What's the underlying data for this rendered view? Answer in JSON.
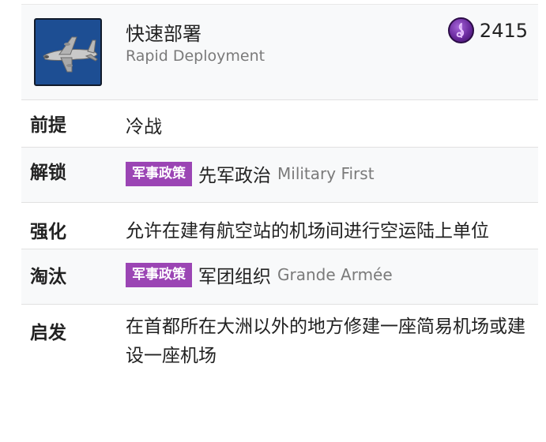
{
  "header": {
    "thumbnail_icon": "cargo-plane-icon",
    "title_zh": "快速部署",
    "title_en": "Rapid Deployment",
    "cost_icon": "civic-culture-icon",
    "cost_value": "2415"
  },
  "colors": {
    "badge_bg": "#9b45b4",
    "thumbnail_bg": "#1d4e93",
    "row_shaded_bg": "#f8f9fa",
    "secondary_text": "#7a7a7a"
  },
  "rows": {
    "prerequisite": {
      "label": "前提",
      "value": "冷战"
    },
    "unlocks": {
      "label": "解锁",
      "badge": "军事政策",
      "value_zh": "先军政治",
      "value_en": "Military First"
    },
    "boost": {
      "label": "强化",
      "value": "允许在建有航空站的机场间进行空运陆上单位"
    },
    "obsoleted_by": {
      "label": "淘汰",
      "badge": "军事政策",
      "value_zh": "军团组织",
      "value_en": "Grande Armée"
    },
    "inspiration": {
      "label": "启发",
      "value": "在首都所在大洲以外的地方修建一座简易机场或建设一座机场"
    }
  }
}
